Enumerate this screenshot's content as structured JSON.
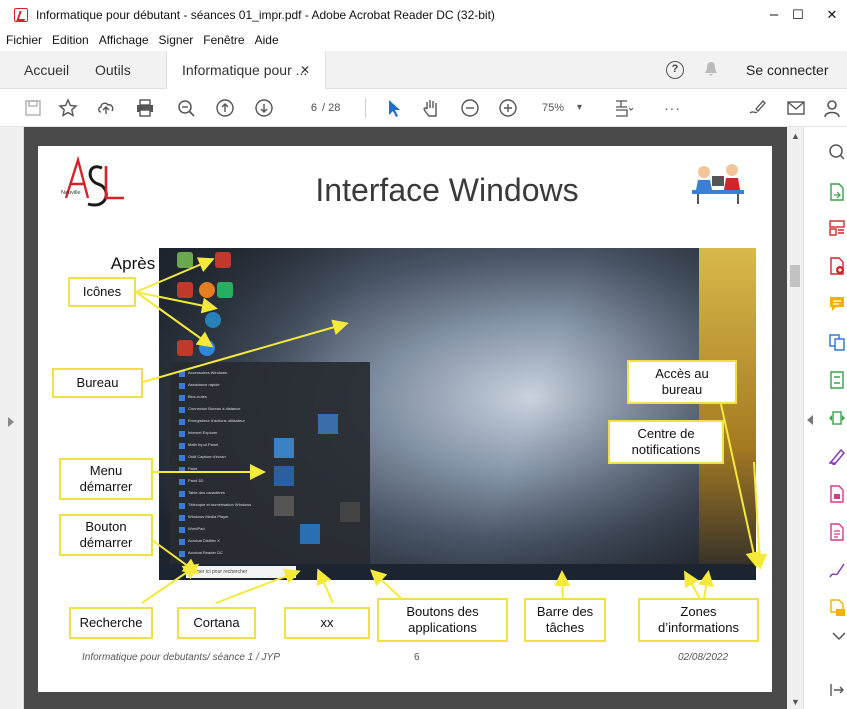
{
  "window": {
    "title": "Informatique pour débutant - séances 01_impr.pdf - Adobe Acrobat Reader DC (32-bit)",
    "minimize": "–",
    "maximize": "☐",
    "close": "✕"
  },
  "menu": {
    "items": [
      "Fichier",
      "Edition",
      "Affichage",
      "Signer",
      "Fenêtre",
      "Aide"
    ]
  },
  "tabs": {
    "home": "Accueil",
    "tools": "Outils",
    "document": "Informatique pour ...",
    "close": "✕",
    "help": "?",
    "sign_in": "Se connecter"
  },
  "toolbar": {
    "page_current": "6",
    "page_total": "/ 28",
    "zoom": "75%",
    "zoom_caret": "▾",
    "more": "···"
  },
  "slide": {
    "title": "Interface Windows",
    "subtitle": "Après démarrage du système et connexion, le bureau s’affiche sur le moniteur",
    "logo_text": "Neuville",
    "logo_text_2": "ASL",
    "search_placeholder": "Taper ici pour rechercher",
    "callouts": {
      "icones": "Icônes",
      "bureau": "Bureau",
      "menu_demarrer_1": "Menu",
      "menu_demarrer_2": "démarrer",
      "bouton_demarrer_1": "Bouton",
      "bouton_demarrer_2": "démarrer",
      "acces_bureau_1": "Accès au",
      "acces_bureau_2": "bureau",
      "centre_notif_1": "Centre de",
      "centre_notif_2": "notifications",
      "recherche": "Recherche",
      "cortana": "Cortana",
      "xx": "xx",
      "boutons_app_1": "Boutons des",
      "boutons_app_2": "applications",
      "barre_taches_1": "Barre des",
      "barre_taches_2": "tâches",
      "zones_info_1": "Zones",
      "zones_info_2": "d’informations"
    },
    "footer_left": "Informatique pour debutants/ séance 1 / JYP",
    "footer_center": "6",
    "footer_right": "02/08/2022"
  },
  "colors": {
    "accent_red": "#d4242a",
    "callout_border": "#f0e14a",
    "arrow_yellow": "#f5ea3a",
    "rightpanel_purple": "#8a3ab9"
  }
}
